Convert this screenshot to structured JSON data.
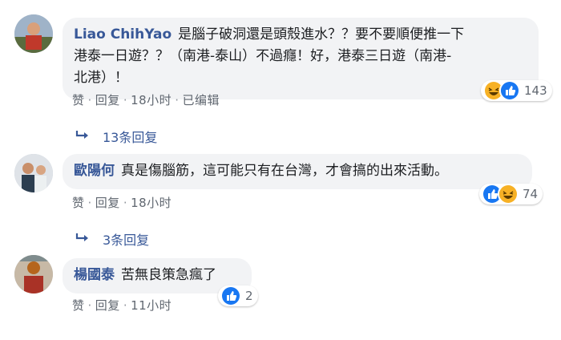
{
  "comments": [
    {
      "author": "Liao ChihYao",
      "text_line1": "是腦子破洞還是頭殼進水？？要不要順便推一下",
      "text_line2": "港泰一日遊？？（南港-泰山）不過癮！好，港泰三日遊（南港-",
      "text_line3": "北港）！",
      "actions": {
        "like": "赞",
        "reply": "回复",
        "time": "18小时",
        "edited": "已编辑"
      },
      "reaction_icons": [
        "haha-icon",
        "like-icon"
      ],
      "reaction_count": "143",
      "replies_label": "13条回复"
    },
    {
      "author": "歐陽何",
      "text_line1": "真是傷腦筋，這可能只有在台灣，才會搞的出來活動。",
      "actions": {
        "like": "赞",
        "reply": "回复",
        "time": "18小时"
      },
      "reaction_icons": [
        "like-icon",
        "haha-icon"
      ],
      "reaction_count": "74",
      "replies_label": "3条回复"
    },
    {
      "author": "楊國泰",
      "text_line1": "苦無良策急瘋了",
      "actions": {
        "like": "赞",
        "reply": "回复",
        "time": "11小时"
      },
      "reaction_icons": [
        "like-icon"
      ],
      "reaction_count": "2"
    }
  ],
  "colors": {
    "author": "#385898",
    "bubble": "#f2f3f5",
    "meta": "#606770",
    "like_blue": "#1877f2",
    "haha_yellow": "#f7b125"
  }
}
